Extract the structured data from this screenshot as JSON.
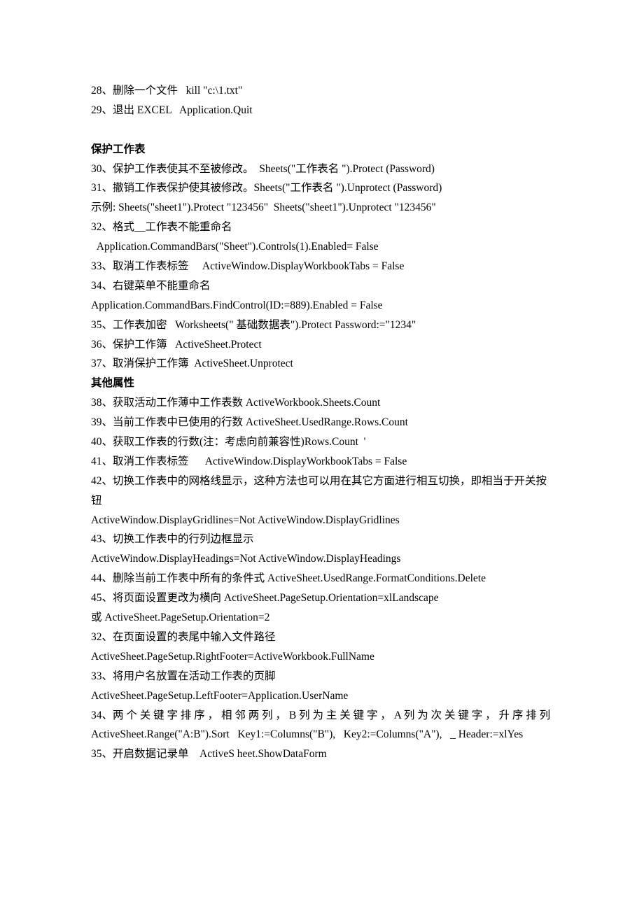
{
  "lines": [
    {
      "text": "28、删除一个文件   kill \"c:\\1.txt\"",
      "bold": false
    },
    {
      "text": "29、退出 EXCEL   Application.Quit",
      "bold": false
    },
    {
      "text": " ",
      "bold": false
    },
    {
      "text": "保护工作表",
      "bold": true
    },
    {
      "text": "30、保护工作表使其不至被修改。  Sheets(\"工作表名 \").Protect (Password)",
      "bold": false
    },
    {
      "text": "31、撤销工作表保护使其被修改。Sheets(\"工作表名 \").Unprotect (Password)",
      "bold": false
    },
    {
      "text": "示例: Sheets(\"sheet1\").Protect \"123456\"  Sheets(\"sheet1\").Unprotect \"123456\"",
      "bold": false
    },
    {
      "text": "32、格式__工作表不能重命名",
      "bold": false
    },
    {
      "text": "  Application.CommandBars(\"Sheet\").Controls(1).Enabled= False",
      "bold": false
    },
    {
      "text": "33、取消工作表标签     ActiveWindow.DisplayWorkbookTabs = False",
      "bold": false
    },
    {
      "text": "34、右键菜单不能重命名",
      "bold": false
    },
    {
      "text": "Application.CommandBars.FindControl(ID:=889).Enabled = False",
      "bold": false
    },
    {
      "text": "35、工作表加密   Worksheets(\" 基础数据表\").Protect Password:=\"1234\"",
      "bold": false
    },
    {
      "text": "36、保护工作簿   ActiveSheet.Protect",
      "bold": false
    },
    {
      "text": "37、取消保护工作簿  ActiveSheet.Unprotect",
      "bold": false
    },
    {
      "text": "其他属性",
      "bold": true
    },
    {
      "text": "38、获取活动工作薄中工作表数 ActiveWorkbook.Sheets.Count",
      "bold": false
    },
    {
      "text": "39、当前工作表中已使用的行数 ActiveSheet.UsedRange.Rows.Count",
      "bold": false
    },
    {
      "text": "40、获取工作表的行数(注：考虑向前兼容性)Rows.Count  '",
      "bold": false
    },
    {
      "text": "41、取消工作表标签      ActiveWindow.DisplayWorkbookTabs = False",
      "bold": false
    },
    {
      "text": "42、切换工作表中的网格线显示，这种方法也可以用在其它方面进行相互切换，即相当于开关按钮",
      "bold": false
    },
    {
      "text": "ActiveWindow.DisplayGridlines=Not ActiveWindow.DisplayGridlines",
      "bold": false
    },
    {
      "text": "43、切换工作表中的行列边框显示",
      "bold": false
    },
    {
      "text": "ActiveWindow.DisplayHeadings=Not ActiveWindow.DisplayHeadings",
      "bold": false
    },
    {
      "text": "44、删除当前工作表中所有的条件式 ActiveSheet.UsedRange.FormatConditions.Delete",
      "bold": false
    },
    {
      "text": "45、将页面设置更改为横向 ActiveSheet.PageSetup.Orientation=xlLandscape",
      "bold": false
    },
    {
      "text": "或 ActiveSheet.PageSetup.Orientation=2",
      "bold": false
    },
    {
      "text": "32、在页面设置的表尾中输入文件路径",
      "bold": false
    },
    {
      "text": "ActiveSheet.PageSetup.RightFooter=ActiveWorkbook.FullName",
      "bold": false
    },
    {
      "text": "33、将用户名放置在活动工作表的页脚",
      "bold": false
    },
    {
      "text": "ActiveSheet.PageSetup.LeftFooter=Application.UserName",
      "bold": false
    },
    {
      "text": "34、两 个 关 键 字 排 序 ， 相 邻 两 列 ， B 列 为 主 关 键 字 ， A 列 为 次 关 键 字 ， 升 序 排 列 ActiveSheet.Range(\"A:B\").Sort   Key1:=Columns(\"B\"),   Key2:=Columns(\"A\"),   _ Header:=xlYes",
      "bold": false
    },
    {
      "text": "35、开启数据记录单    ActiveS heet.ShowDataForm",
      "bold": false
    }
  ]
}
